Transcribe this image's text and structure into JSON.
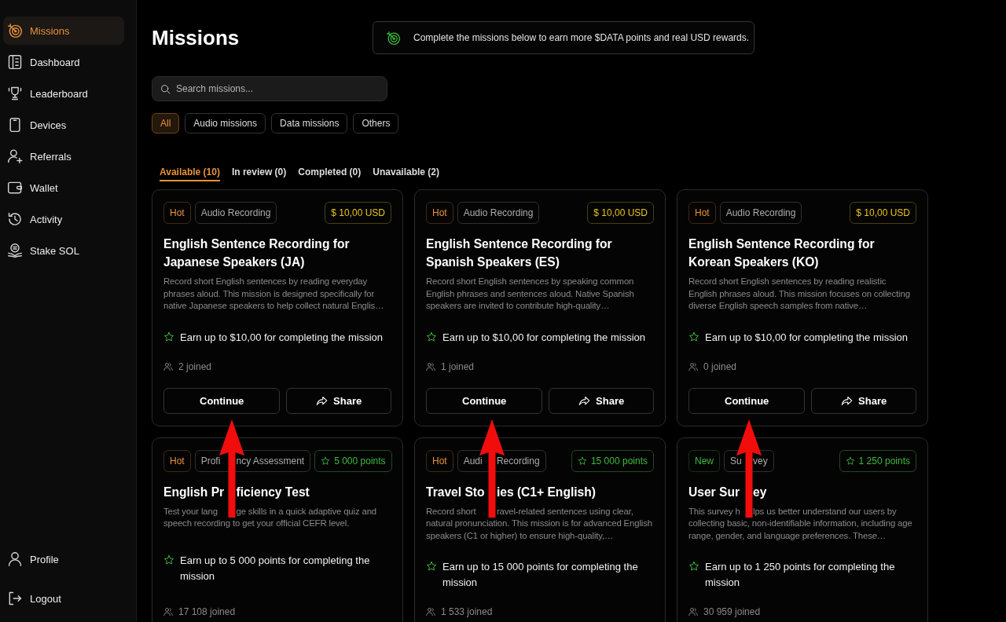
{
  "sidebar": {
    "items": [
      {
        "label": "Missions",
        "selected": true
      },
      {
        "label": "Dashboard",
        "selected": false
      },
      {
        "label": "Leaderboard",
        "selected": false
      },
      {
        "label": "Devices",
        "selected": false
      },
      {
        "label": "Referrals",
        "selected": false
      },
      {
        "label": "Wallet",
        "selected": false
      },
      {
        "label": "Activity",
        "selected": false
      },
      {
        "label": "Stake SOL",
        "selected": false
      }
    ],
    "footer_items": [
      {
        "label": "Profile",
        "selected": false
      },
      {
        "label": "Logout",
        "selected": false
      }
    ]
  },
  "header": {
    "title": "Missions",
    "banner": "Complete the missions below to earn more $DATA points and real USD rewards."
  },
  "search": {
    "placeholder": "Search missions..."
  },
  "filters": [
    {
      "label": "All",
      "selected": true
    },
    {
      "label": "Audio missions",
      "selected": false
    },
    {
      "label": "Data missions",
      "selected": false
    },
    {
      "label": "Others",
      "selected": false
    }
  ],
  "tabs": [
    {
      "label": "Available (10)",
      "selected": true
    },
    {
      "label": "In review (0)",
      "selected": false
    },
    {
      "label": "Completed (0)",
      "selected": false
    },
    {
      "label": "Unavailable (2)",
      "selected": false
    }
  ],
  "missions": [
    {
      "status": {
        "label": "Hot",
        "color": "#e8913a"
      },
      "category": [
        "Audio Recording"
      ],
      "reward_badge": {
        "kind": "usd",
        "text": "$ 10,00 USD"
      },
      "title": [
        "English Sentence Recording for Japanese Speakers (JA)"
      ],
      "description": [
        "Record short English sentences by reading everyday phrases aloud. This mission is designed specifically for native Japanese speakers to help collect natural Englis…"
      ],
      "reward": "Earn up to $10,00 for completing the mission",
      "joined": "2 joined",
      "buttons": [
        {
          "kind": "continue",
          "label": "Continue"
        },
        {
          "kind": "share",
          "label": "Share"
        }
      ],
      "arrow_annotation": false
    },
    {
      "status": {
        "label": "Hot",
        "color": "#e8913a"
      },
      "category": [
        "Audio Recording"
      ],
      "reward_badge": {
        "kind": "usd",
        "text": "$ 10,00 USD"
      },
      "title": [
        "English Sentence Recording for Spanish Speakers (ES)"
      ],
      "description": [
        "Record short English sentences by speaking common English phrases and sentences aloud. Native Spanish speakers are invited to contribute high-quality…"
      ],
      "reward": "Earn up to $10,00 for completing the mission",
      "joined": "1 joined",
      "buttons": [
        {
          "kind": "continue",
          "label": "Continue"
        },
        {
          "kind": "share",
          "label": "Share"
        }
      ],
      "arrow_annotation": false
    },
    {
      "status": {
        "label": "Hot",
        "color": "#e8913a"
      },
      "category": [
        "Audio Recording"
      ],
      "reward_badge": {
        "kind": "usd",
        "text": "$ 10,00 USD"
      },
      "title": [
        "English Sentence Recording for Korean Speakers (KO)"
      ],
      "description": [
        "Record short English sentences by reading realistic English phrases aloud. This mission focuses on collecting diverse English speech samples from native…"
      ],
      "reward": "Earn up to $10,00 for completing the mission",
      "joined": "0 joined",
      "buttons": [
        {
          "kind": "continue",
          "label": "Continue"
        },
        {
          "kind": "share",
          "label": "Share"
        }
      ],
      "arrow_annotation": false
    },
    {
      "status": {
        "label": "Hot",
        "color": "#e8913a"
      },
      "category": [
        "Profi",
        "ncy Assessment"
      ],
      "reward_badge": {
        "kind": "points",
        "text": "5 000 points"
      },
      "title": [
        "English Pr",
        "ficiency Test"
      ],
      "description": [
        "Test your lang",
        "ge skills in a quick adaptive quiz and speech recording to get your official CEFR level."
      ],
      "reward": "Earn up to 5 000 points for completing the mission",
      "joined": "17 108 joined",
      "arrow_annotation": true
    },
    {
      "status": {
        "label": "Hot",
        "color": "#e8913a"
      },
      "category": [
        "Audi",
        "Recording"
      ],
      "reward_badge": {
        "kind": "points",
        "text": "15 000 points"
      },
      "title": [
        "Travel Sto",
        "ies (C1+ English)"
      ],
      "description": [
        "Record short",
        "ravel-related sentences using clear, natural pronunciation. This mission is for advanced English speakers (C1 or higher) to ensure high-quality,…"
      ],
      "reward": "Earn up to 15 000 points for completing the mission",
      "joined": "1 533 joined",
      "arrow_annotation": true
    },
    {
      "status": {
        "label": "New",
        "color": "#3dbb3d"
      },
      "category": [
        "Su",
        "vey"
      ],
      "reward_badge": {
        "kind": "points",
        "text": "1 250 points"
      },
      "title": [
        "User Sur",
        "ey"
      ],
      "description": [
        "This survey h",
        "lps us better understand our users by collecting basic, non-identifiable information, including age range, gender, and language preferences. These…"
      ],
      "reward": "Earn up to 1 250 points for completing the mission",
      "joined": "30 959 joined",
      "arrow_annotation": true
    }
  ]
}
